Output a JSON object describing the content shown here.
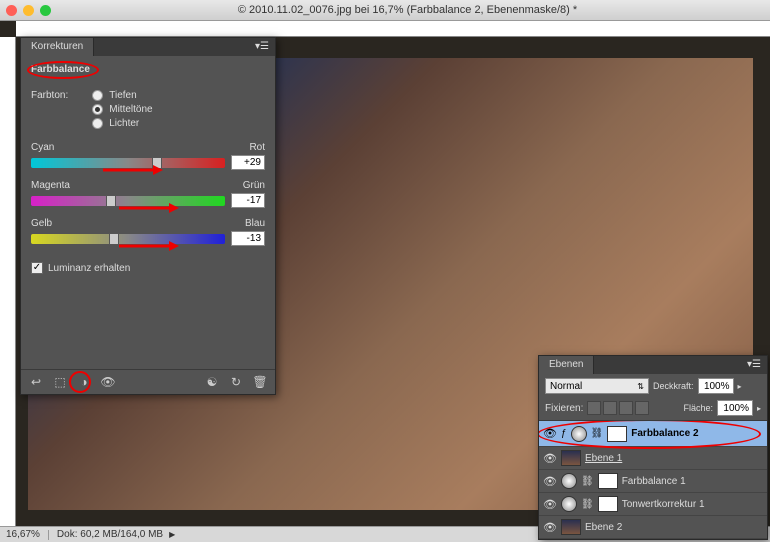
{
  "window": {
    "title": "© 2010.11.02_0076.jpg bei 16,7% (Farbbalance 2, Ebenenmaske/8) *"
  },
  "statusbar": {
    "zoom": "16,67%",
    "doc": "Dok: 60,2 MB/164,0 MB"
  },
  "adjustments": {
    "tab": "Korrekturen",
    "title": "Farbbalance",
    "tone_label": "Farbton:",
    "tiefen": "Tiefen",
    "mitteltoene": "Mitteltöne",
    "lichter": "Lichter",
    "sliders": {
      "cr": {
        "left": "Cyan",
        "right": "Rot",
        "value": "+29",
        "thumb_pct": 65
      },
      "mg": {
        "left": "Magenta",
        "right": "Grün",
        "value": "-17",
        "thumb_pct": 41
      },
      "yb": {
        "left": "Gelb",
        "right": "Blau",
        "value": "-13",
        "thumb_pct": 43
      }
    },
    "preserve_lum": "Luminanz erhalten"
  },
  "layers": {
    "tab": "Ebenen",
    "blend_mode": "Normal",
    "opacity_label": "Deckkraft:",
    "opacity": "100%",
    "lock_label": "Fixieren:",
    "fill_label": "Fläche:",
    "fill": "100%",
    "items": [
      {
        "name": "Farbbalance 2",
        "selected": true,
        "adj": true,
        "mask": true
      },
      {
        "name": "Ebene 1",
        "selected": false,
        "adj": false,
        "mask": false,
        "underlined": true
      },
      {
        "name": "Farbbalance 1",
        "selected": false,
        "adj": true,
        "mask": true
      },
      {
        "name": "Tonwertkorrektur 1",
        "selected": false,
        "adj": true,
        "mask": true
      },
      {
        "name": "Ebene 2",
        "selected": false,
        "adj": false,
        "mask": false
      }
    ]
  }
}
